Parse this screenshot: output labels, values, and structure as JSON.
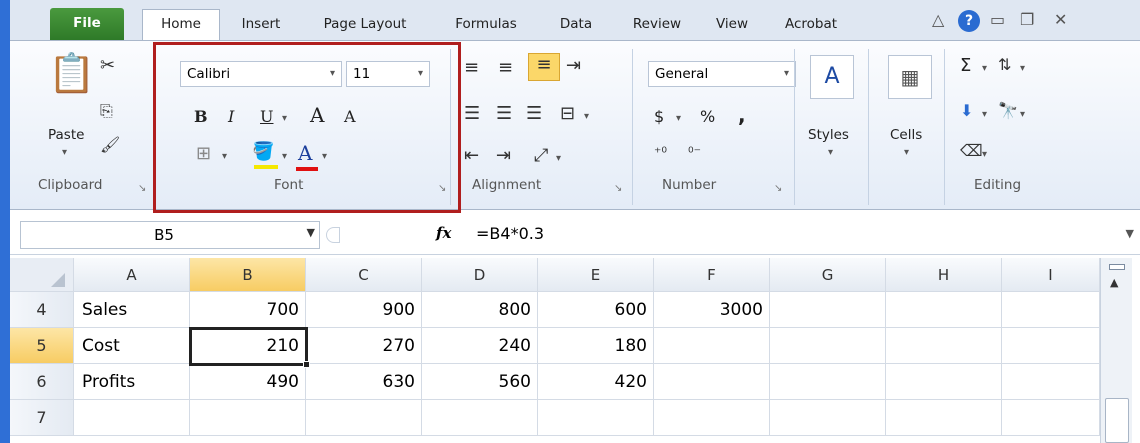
{
  "tabs": [
    "File",
    "Home",
    "Insert",
    "Page Layout",
    "Formulas",
    "Data",
    "Review",
    "View",
    "Acrobat"
  ],
  "window_controls": {
    "help": "?"
  },
  "ribbon": {
    "clipboard": {
      "label": "Clipboard",
      "paste": "Paste"
    },
    "font": {
      "label": "Font",
      "font_name": "Calibri",
      "font_size": "11",
      "bold": "B",
      "italic": "I",
      "underline": "U",
      "grow": "A",
      "shrink": "A",
      "font_color": "A"
    },
    "alignment": {
      "label": "Alignment"
    },
    "number": {
      "label": "Number",
      "format": "General",
      "currency": "$",
      "percent": "%",
      "comma": ","
    },
    "styles": {
      "label": "Styles"
    },
    "cells": {
      "label": "Cells"
    },
    "editing": {
      "label": "Editing",
      "sum": "Σ"
    }
  },
  "formula_bar": {
    "name_box": "B5",
    "fx": "fx",
    "formula": "=B4*0.3"
  },
  "grid": {
    "columns": [
      "A",
      "B",
      "C",
      "D",
      "E",
      "F",
      "G",
      "H",
      "I"
    ],
    "selected_column": "B",
    "rows": [
      {
        "num": "4",
        "cells": [
          "Sales",
          "700",
          "900",
          "800",
          "600",
          "3000",
          "",
          "",
          ""
        ]
      },
      {
        "num": "5",
        "cells": [
          "Cost",
          "210",
          "270",
          "240",
          "180",
          "",
          "",
          "",
          ""
        ]
      },
      {
        "num": "6",
        "cells": [
          "Profits",
          "490",
          "630",
          "560",
          "420",
          "",
          "",
          "",
          ""
        ]
      },
      {
        "num": "7",
        "cells": [
          "",
          "",
          "",
          "",
          "",
          "",
          "",
          "",
          ""
        ]
      }
    ],
    "active_cell": "B5"
  },
  "colors": {
    "file_tab": "#2e7a28",
    "highlight_box": "#b01e1e",
    "selected_header": "#f7cc63"
  }
}
